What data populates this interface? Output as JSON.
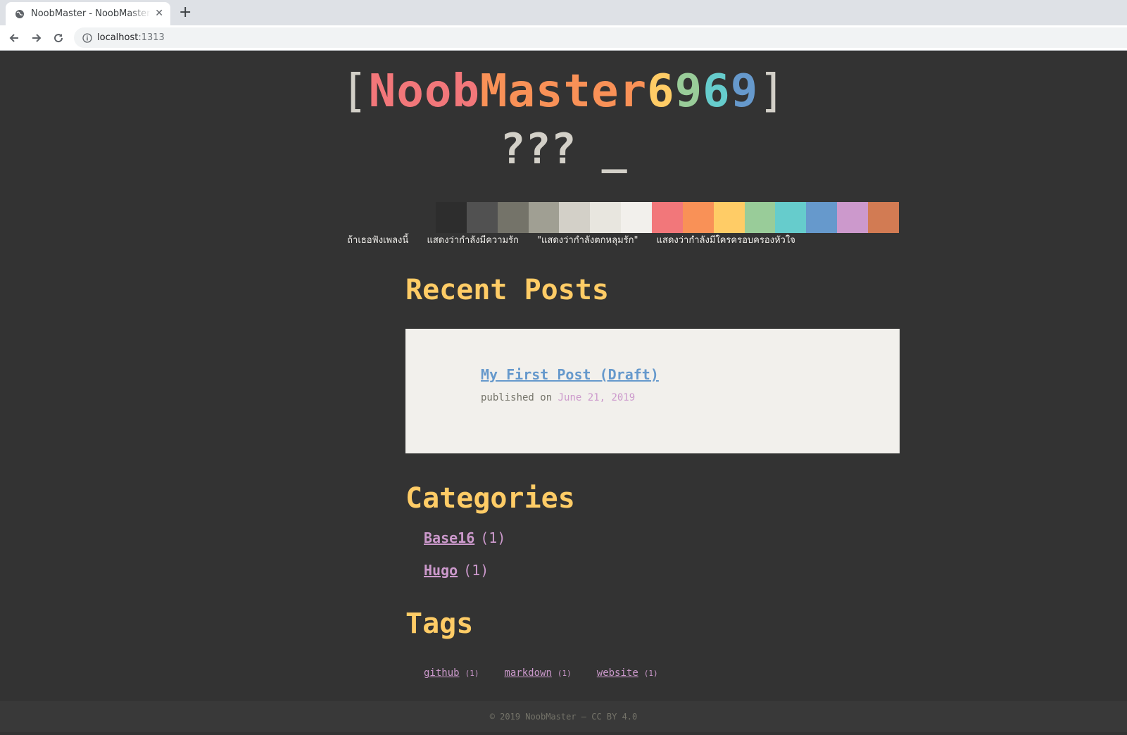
{
  "browser": {
    "tab_title": "NoobMaster - NoobMaster",
    "tab_close": "✕",
    "new_tab": "+",
    "url_host": "localhost",
    "url_port": ":1313"
  },
  "header": {
    "title_open": "[",
    "title_parts": [
      "Noob",
      "Master",
      "6",
      "9",
      "6",
      "9"
    ],
    "title_close": "]",
    "subtitle": "??? _",
    "tagline_parts": [
      "ถ้าเธอฟังเพลงนี้",
      "แสดงว่ากำลังมีความรัก",
      "\"แสดงว่ากำลังตกหลุมรัก\"",
      "แสดงว่ากำลังมีใครครอบครองหัวใจ"
    ]
  },
  "palette": [
    "#2d2d2d",
    "#515151",
    "#747369",
    "#a09f93",
    "#d3d0c8",
    "#e8e6df",
    "#f2f0ec",
    "#f2777a",
    "#f99157",
    "#ffcc66",
    "#99cc99",
    "#66cccc",
    "#6699cc",
    "#cc99cc",
    "#d27b53"
  ],
  "title_colors": [
    "#f2777a",
    "#f99157",
    "#ffcc66",
    "#99cc99",
    "#66cccc",
    "#6699cc"
  ],
  "recent_posts": {
    "heading": "Recent Posts",
    "posts": [
      {
        "title": "My First Post (Draft)",
        "published_label": "published on",
        "date": "June 21, 2019"
      }
    ]
  },
  "categories": {
    "heading": "Categories",
    "items": [
      {
        "name": "Base16",
        "count": "(1)"
      },
      {
        "name": "Hugo",
        "count": "(1)"
      }
    ]
  },
  "tags": {
    "heading": "Tags",
    "items": [
      {
        "name": "github",
        "count": "(1)"
      },
      {
        "name": "markdown",
        "count": "(1)"
      },
      {
        "name": "website",
        "count": "(1)"
      }
    ]
  },
  "footer": {
    "text": "© 2019 NoobMaster — CC BY 4.0"
  }
}
